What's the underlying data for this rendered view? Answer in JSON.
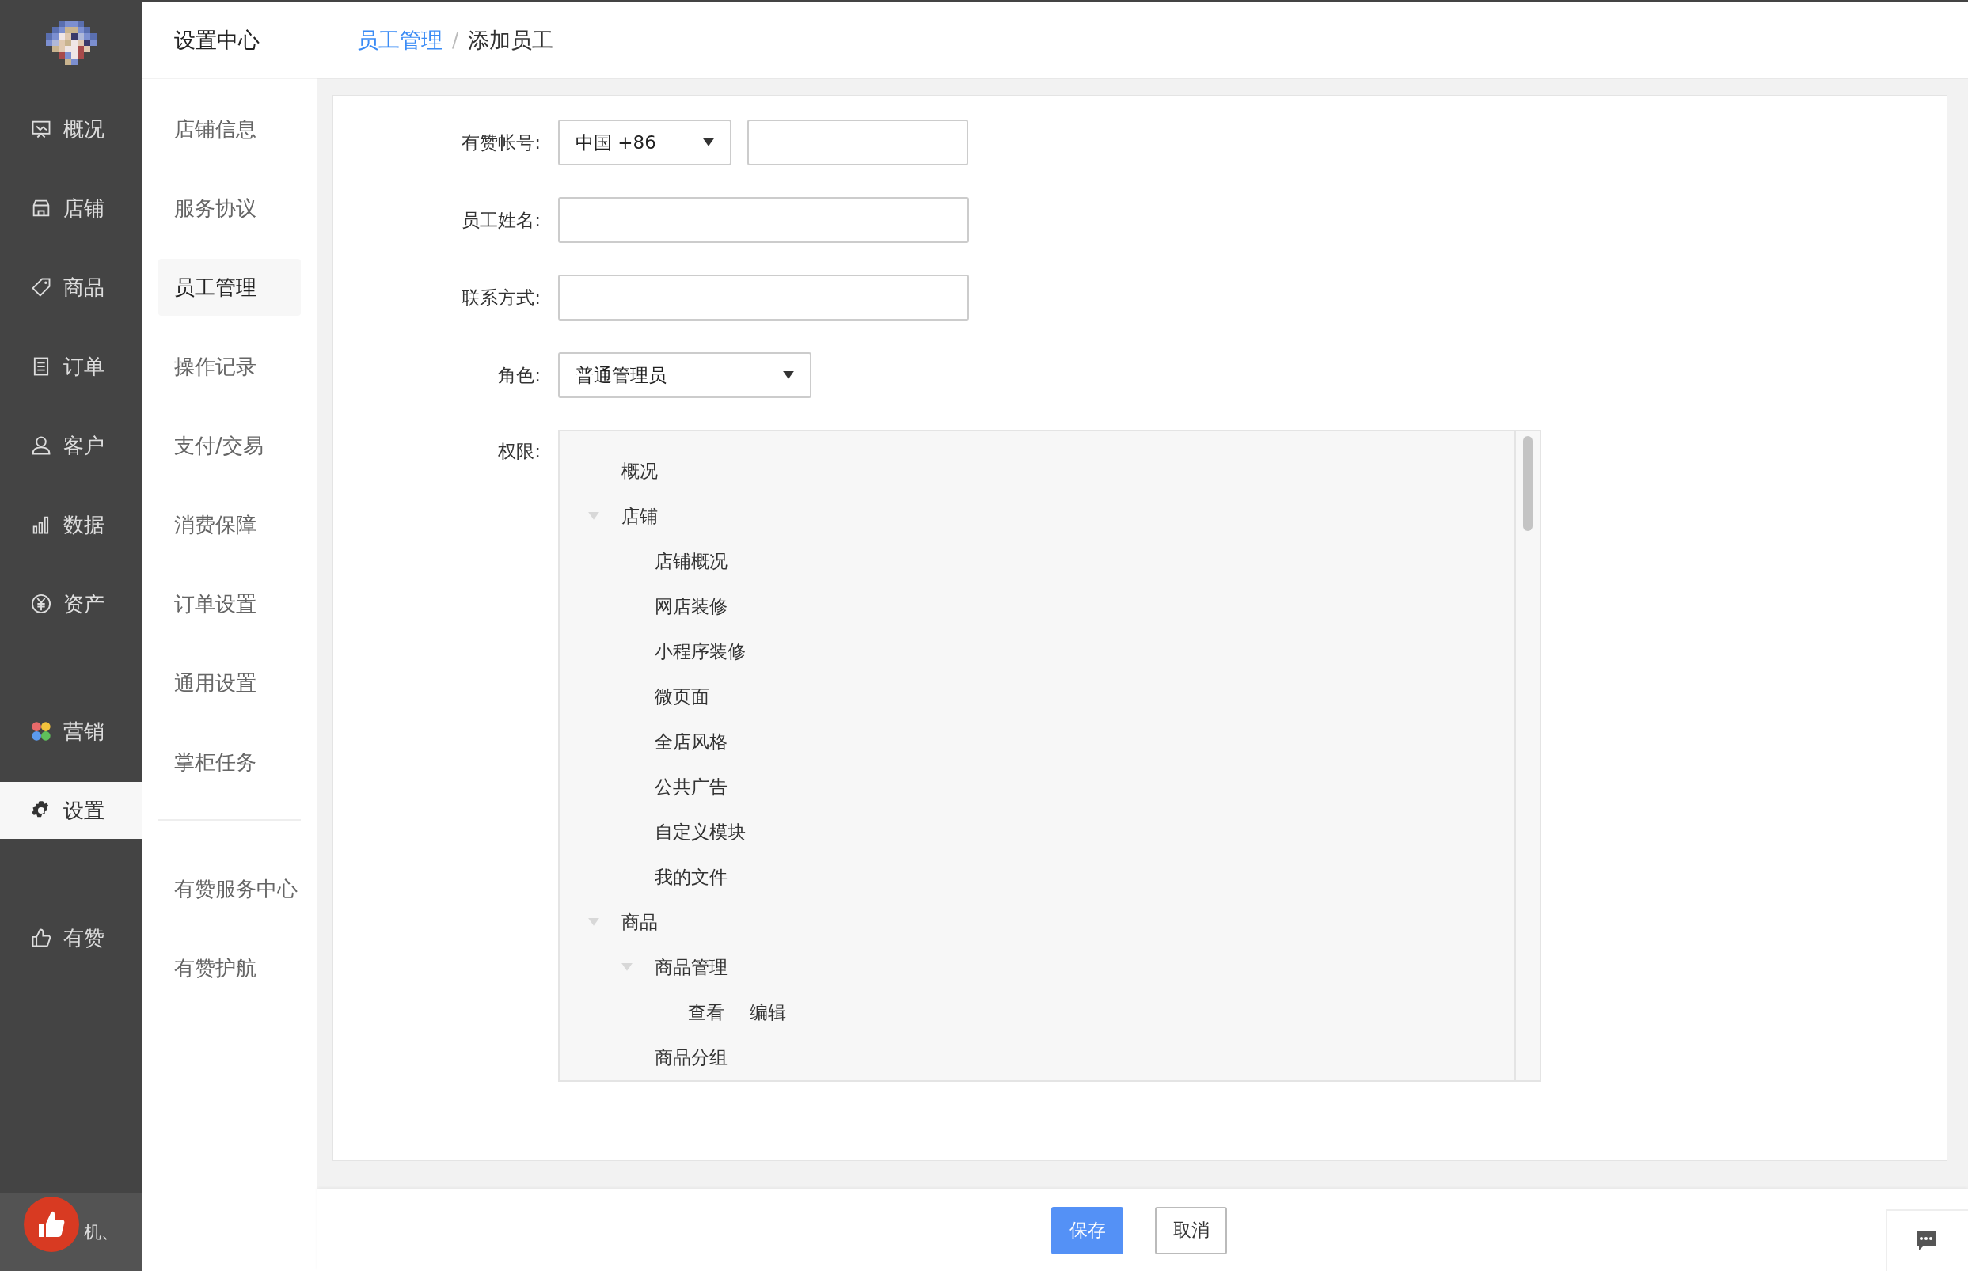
{
  "main_nav": {
    "groups": [
      [
        {
          "label": "概况",
          "selected": false
        },
        {
          "label": "店铺",
          "selected": false
        },
        {
          "label": "商品",
          "selected": false
        },
        {
          "label": "订单",
          "selected": false
        },
        {
          "label": "客户",
          "selected": false
        },
        {
          "label": "数据",
          "selected": false
        },
        {
          "label": "资产",
          "selected": false
        }
      ],
      [
        {
          "label": "营销",
          "selected": false
        },
        {
          "label": "设置",
          "selected": true
        }
      ],
      [
        {
          "label": "有赞",
          "selected": false
        }
      ]
    ],
    "user": {
      "name": "机、"
    }
  },
  "sub_nav": {
    "title": "设置中心",
    "groups": [
      [
        {
          "label": "店铺信息",
          "selected": false
        },
        {
          "label": "服务协议",
          "selected": false
        },
        {
          "label": "员工管理",
          "selected": true
        },
        {
          "label": "操作记录",
          "selected": false
        },
        {
          "label": "支付/交易",
          "selected": false
        },
        {
          "label": "消费保障",
          "selected": false
        },
        {
          "label": "订单设置",
          "selected": false
        },
        {
          "label": "通用设置",
          "selected": false
        },
        {
          "label": "掌柜任务",
          "selected": false
        }
      ],
      [
        {
          "label": "有赞服务中心",
          "selected": false
        },
        {
          "label": "有赞护航",
          "selected": false
        }
      ]
    ]
  },
  "breadcrumb_separator": "/",
  "breadcrumb": [
    {
      "label": "员工管理",
      "kind": "link"
    },
    {
      "label": "添加员工",
      "kind": "current"
    }
  ],
  "form": {
    "fields": [
      {
        "label": "有赞帐号:",
        "kind": "phone",
        "country": "中国 +86"
      },
      {
        "label": "员工姓名:",
        "kind": "text"
      },
      {
        "label": "联系方式:",
        "kind": "text"
      },
      {
        "label": "角色:",
        "kind": "select",
        "value": "普通管理员"
      },
      {
        "label": "权限:",
        "kind": "tree"
      }
    ],
    "permissions": [
      {
        "label": "概况"
      },
      {
        "label": "店铺",
        "expanded": true,
        "children": [
          {
            "label": "店铺概况"
          },
          {
            "label": "网店装修"
          },
          {
            "label": "小程序装修"
          },
          {
            "label": "微页面"
          },
          {
            "label": "全店风格"
          },
          {
            "label": "公共广告"
          },
          {
            "label": "自定义模块"
          },
          {
            "label": "我的文件"
          }
        ]
      },
      {
        "label": "商品",
        "expanded": true,
        "children": [
          {
            "label": "商品管理",
            "expanded": true,
            "children": [
              {
                "label": "查看",
                "kind": "action"
              },
              {
                "label": "编辑",
                "kind": "action"
              }
            ]
          },
          {
            "label": "商品分组"
          }
        ]
      }
    ]
  },
  "footer": {
    "buttons": [
      {
        "label": "保存",
        "kind": "primary"
      },
      {
        "label": "取消",
        "kind": "default"
      }
    ]
  }
}
